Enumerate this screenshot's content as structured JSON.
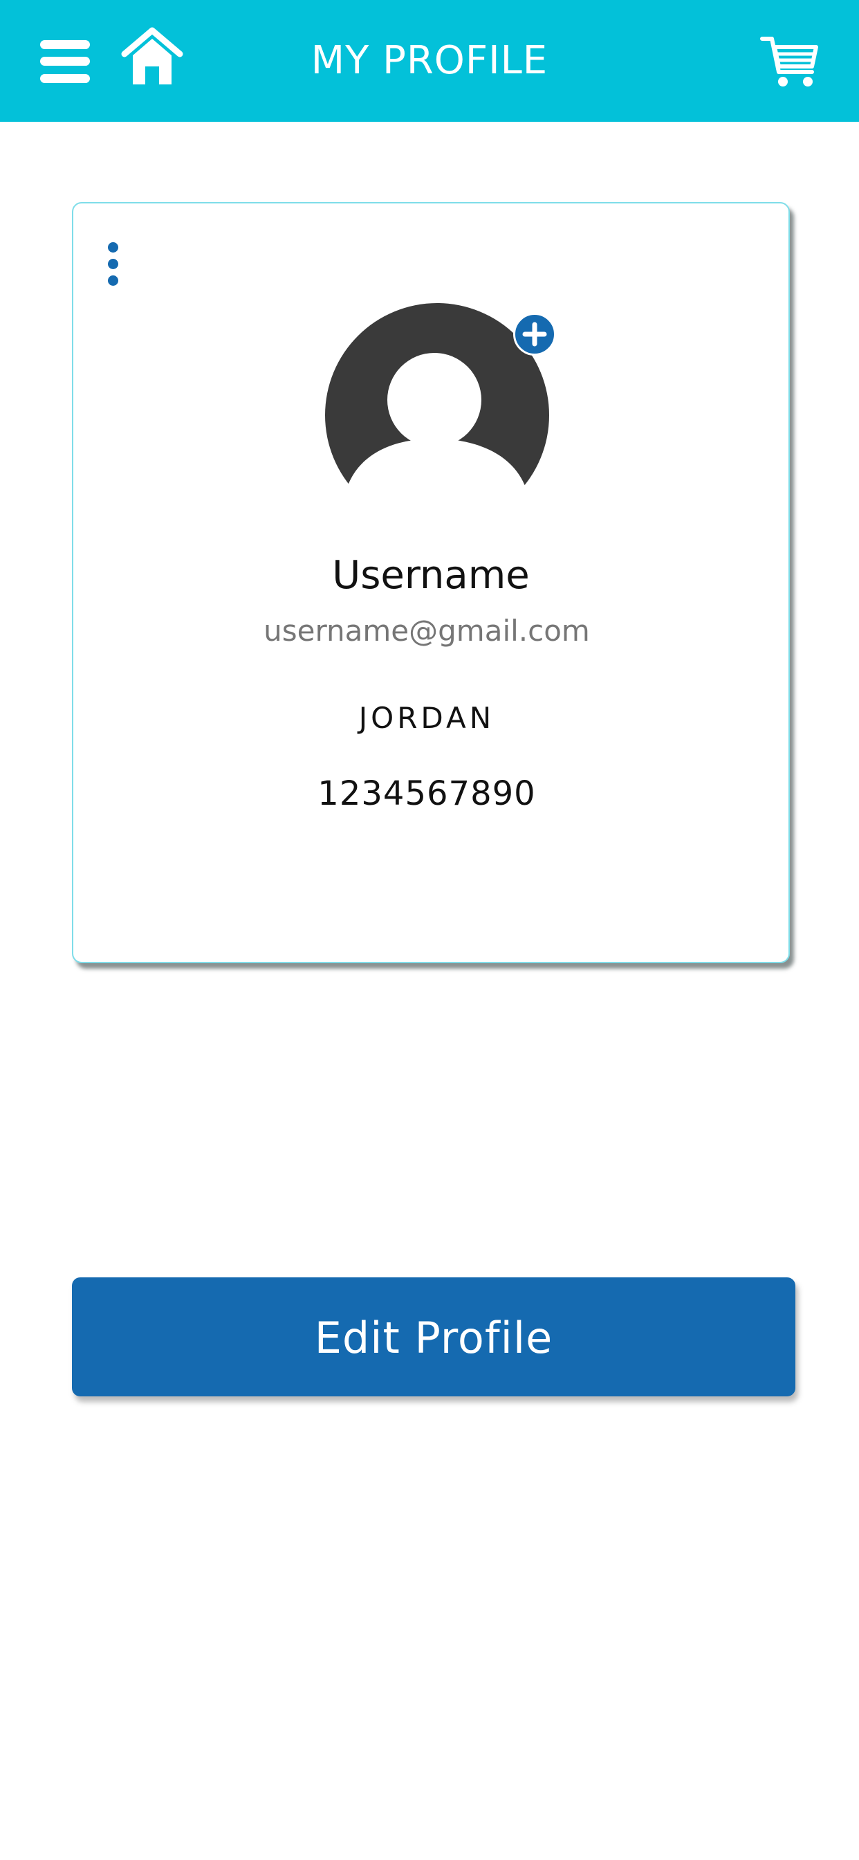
{
  "header": {
    "title": "MY PROFILE",
    "background_color": "#03c1d9",
    "icons": [
      "hamburger-menu-icon",
      "home-icon",
      "shopping-cart-icon"
    ]
  },
  "profile": {
    "username": "Username",
    "email": "username@gmail.com",
    "name": "JORDAN",
    "phone": "1234567890",
    "avatar_icon": "default-user-avatar-icon",
    "add_photo_icon": "plus-circle-icon",
    "options_icon": "kebab-menu-icon"
  },
  "actions": {
    "edit_profile_label": "Edit Profile",
    "button_color": "#156ab0"
  }
}
